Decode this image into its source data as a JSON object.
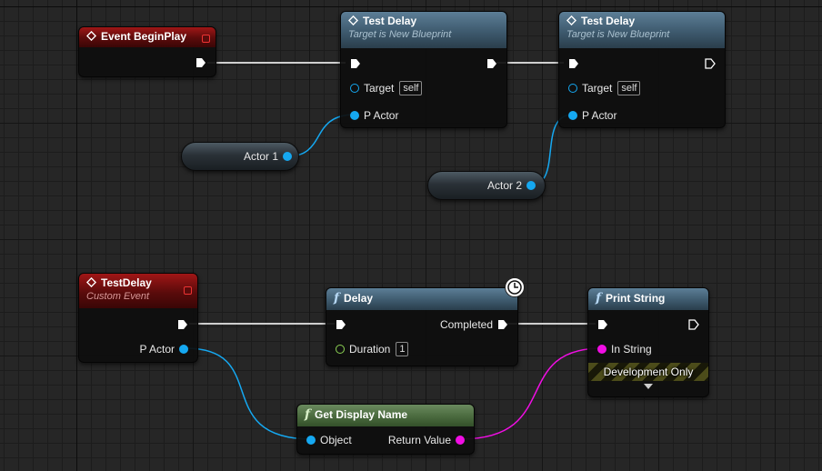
{
  "nodes": {
    "event_beginplay": {
      "title": "Event BeginPlay"
    },
    "test_delay_1": {
      "title": "Test Delay",
      "subtitle": "Target is New Blueprint",
      "target_label": "Target",
      "target_value": "self",
      "pactor_label": "P Actor"
    },
    "test_delay_2": {
      "title": "Test Delay",
      "subtitle": "Target is New Blueprint",
      "target_label": "Target",
      "target_value": "self",
      "pactor_label": "P Actor"
    },
    "actor1": {
      "label": "Actor 1"
    },
    "actor2": {
      "label": "Actor 2"
    },
    "custom_event": {
      "title": "TestDelay",
      "subtitle": "Custom Event",
      "pactor_label": "P Actor"
    },
    "delay": {
      "title": "Delay",
      "completed_label": "Completed",
      "duration_label": "Duration",
      "duration_value": "1"
    },
    "print_string": {
      "title": "Print String",
      "in_string_label": "In String",
      "dev_only_label": "Development Only"
    },
    "get_display_name": {
      "title": "Get Display Name",
      "object_label": "Object",
      "return_label": "Return Value"
    }
  },
  "icons": {
    "event": "event-diamond-icon",
    "function": "function-f-icon",
    "latent": "clock-icon"
  },
  "colors": {
    "exec_wire": "#ffffff",
    "object_pin": "#15a8f1",
    "string_pin": "#f10ee4",
    "float_pin": "#8bd153",
    "event_header": "#a01616",
    "function_header": "#3e5a6e",
    "pure_header": "#4a6a3e"
  }
}
